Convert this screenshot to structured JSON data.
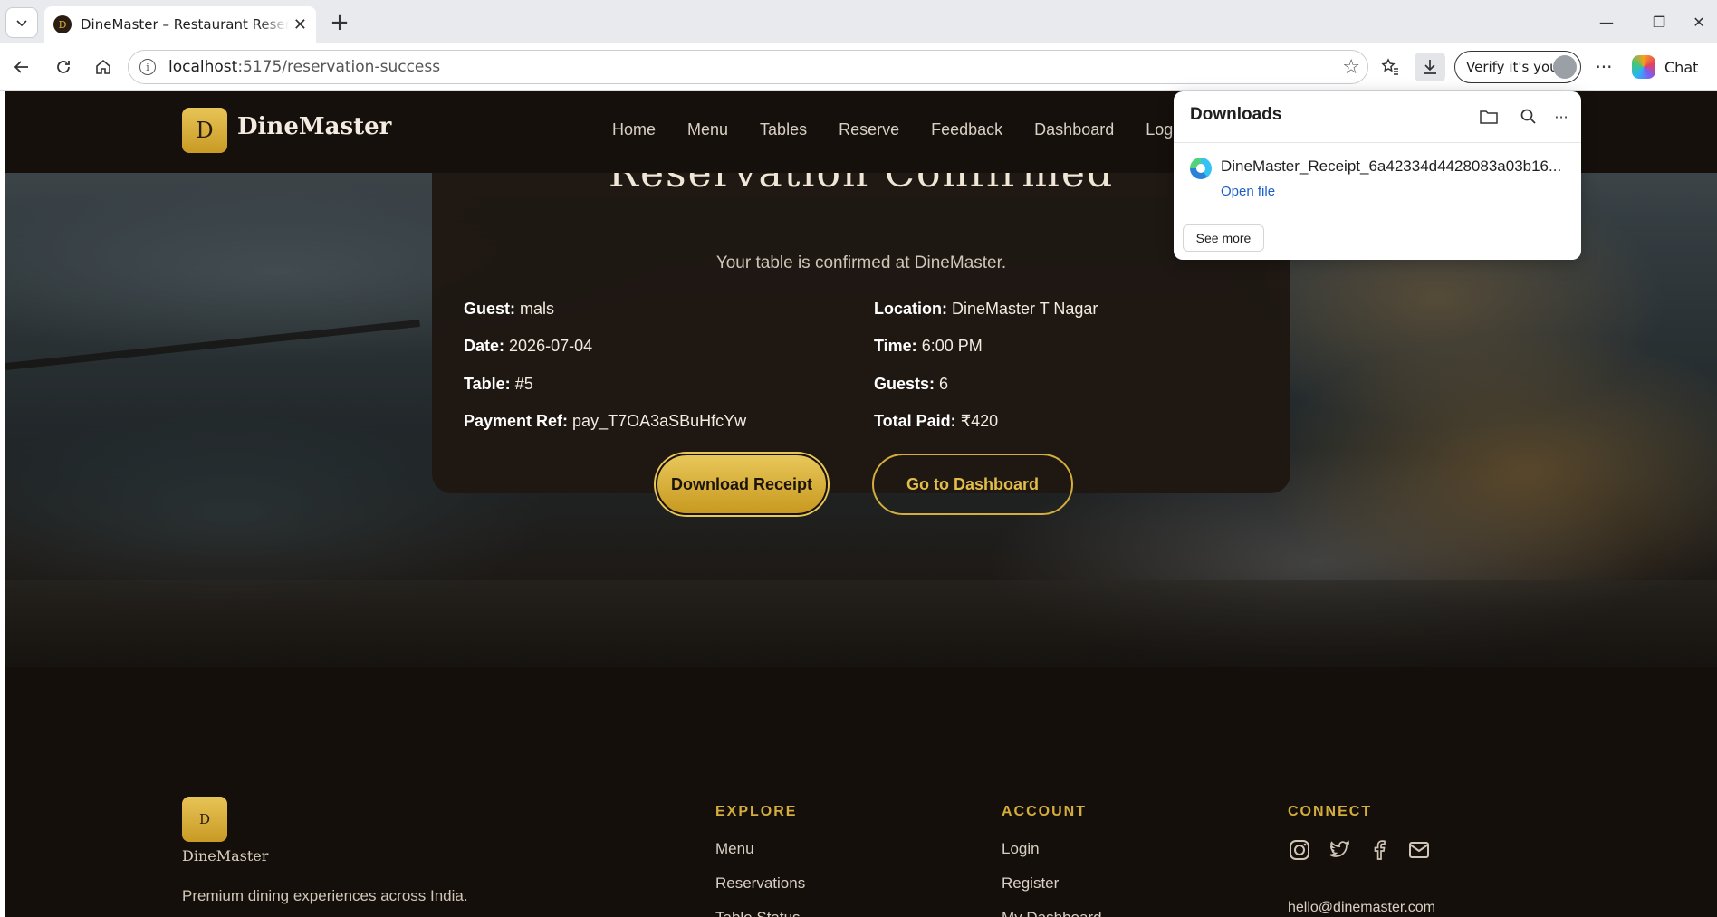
{
  "browser": {
    "tab_title": "DineMaster – Restaurant Reservation",
    "tab_favicon_letter": "D",
    "url_host": "localhost",
    "url_rest": ":5175/reservation-success",
    "verify_label": "Verify it's you",
    "chat_label": "Chat"
  },
  "nav": {
    "logo_letter": "D",
    "brand": "DineMaster",
    "links": [
      "Home",
      "Menu",
      "Tables",
      "Reserve",
      "Feedback",
      "Dashboard",
      "Logout"
    ]
  },
  "card": {
    "title_partial": "Reservation Confirmed",
    "subtitle": "Your table is confirmed at DineMaster.",
    "guest_label": "Guest:",
    "guest_value": "mals",
    "location_label": "Location:",
    "location_value": "DineMaster T Nagar",
    "date_label": "Date:",
    "date_value": "2026-07-04",
    "time_label": "Time:",
    "time_value": "6:00 PM",
    "table_label": "Table:",
    "table_value": "#5",
    "guests_label": "Guests:",
    "guests_value": "6",
    "payment_label": "Payment Ref:",
    "payment_value": "pay_T7OA3aSBuHfcYw",
    "total_label": "Total Paid:",
    "total_value": "₹420",
    "download_btn": "Download Receipt",
    "dashboard_btn": "Go to Dashboard"
  },
  "footer": {
    "logo_letter": "D",
    "brand": "DineMaster",
    "tagline": "Premium dining experiences across India.",
    "explore_heading": "EXPLORE",
    "explore_links": [
      "Menu",
      "Reservations",
      "Table Status"
    ],
    "account_heading": "ACCOUNT",
    "account_links": [
      "Login",
      "Register",
      "My Dashboard"
    ],
    "connect_heading": "CONNECT",
    "email": "hello@dinemaster.com"
  },
  "downloads": {
    "title": "Downloads",
    "filename": "DineMaster_Receipt_6a42334d4428083a03b16...",
    "open_file": "Open file",
    "see_more": "See more"
  },
  "colors": {
    "accent_gold": "#d4ad3c",
    "page_dark": "#150f0b",
    "link_blue": "#1a5fc7"
  }
}
